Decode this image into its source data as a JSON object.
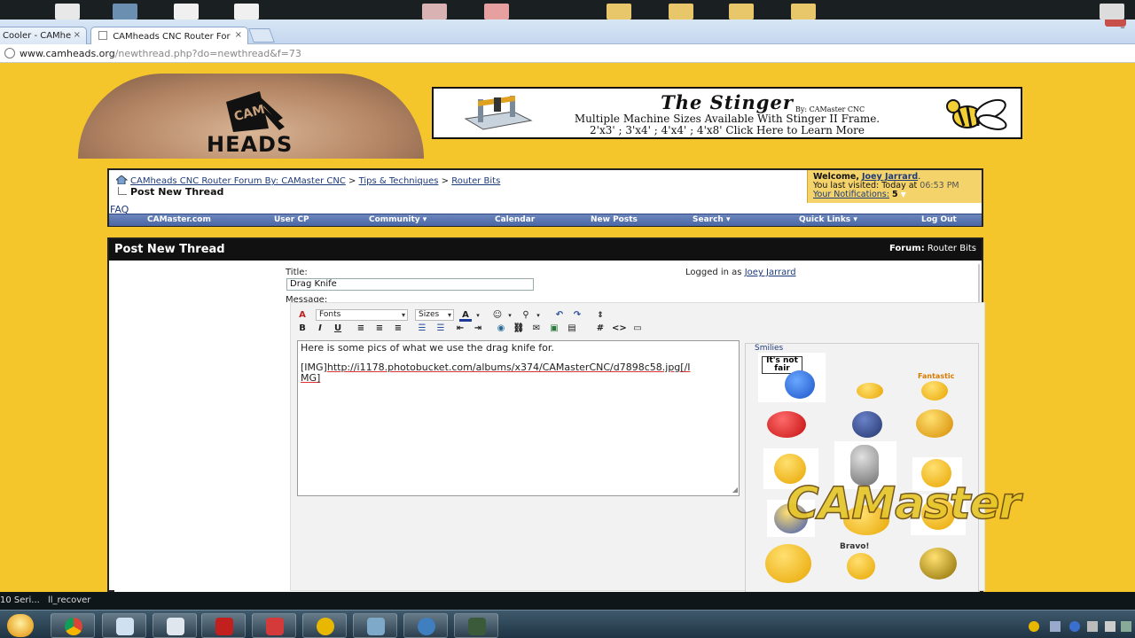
{
  "browser": {
    "tabs": [
      {
        "label": "Cooler - CAMhe"
      },
      {
        "label": "CAMheads CNC Router For"
      }
    ],
    "close_glyph": "×",
    "url_host": "www.camheads.org",
    "url_path": "/newthread.php?do=newthread&f=73"
  },
  "header": {
    "logo_text": "HEADS",
    "banner": {
      "title": "The Stinger",
      "by": "By: CAMaster CNC",
      "line1": "Multiple Machine Sizes Available With Stinger II Frame.",
      "line2": "2'x3' ; 3'x4' ; 4'x4' ; 4'x8'   Click Here to Learn More"
    }
  },
  "nav": {
    "crumbs": [
      "CAMheads CNC Router Forum By: CAMaster CNC",
      "Tips & Techniques",
      "Router Bits"
    ],
    "separator": ">",
    "page_title": "Post New Thread",
    "welcome_prefix": "Welcome,",
    "username": "Joey Jarrard",
    "last_visited_label": "You last visited: Today at",
    "last_visited_time": "06:53 PM",
    "notifications_label": "Your Notifications:",
    "notifications_count": "5",
    "faq": "FAQ",
    "menu": [
      "CAMaster.com",
      "User CP",
      "Community",
      "Calendar",
      "New Posts",
      "Search",
      "Quick Links",
      "Log Out"
    ]
  },
  "post": {
    "header_title": "Post New Thread",
    "forum_label": "Forum:",
    "forum_name": "Router Bits",
    "title_label": "Title:",
    "title_value": "Drag Knife",
    "message_label": "Message:",
    "logged_in_as": "Logged in as",
    "logged_user": "Joey Jarrard",
    "toolbar": {
      "fonts": "Fonts",
      "sizes": "Sizes"
    },
    "message_line1": "Here is some pics of what we use the drag knife for.",
    "message_line2a": "[IMG]",
    "message_line2b": "http://i1178.photobucket.com/albums/x374/CAMasterCNC/d7898c58.jpg[/I",
    "message_line2c": "MG]",
    "smilies_label": "Smilies",
    "smiley_texts": [
      "It's not fair",
      "Fantastic",
      "Bravo!"
    ]
  },
  "watermark": "CAMaster",
  "desktop_labels": [
    "10 Seri...",
    "ll_recover"
  ],
  "colors": {
    "page_bg": "#f5c62c",
    "nav_bar": "#4a67a5",
    "link": "#1d3a7a",
    "header_black": "#111111"
  }
}
